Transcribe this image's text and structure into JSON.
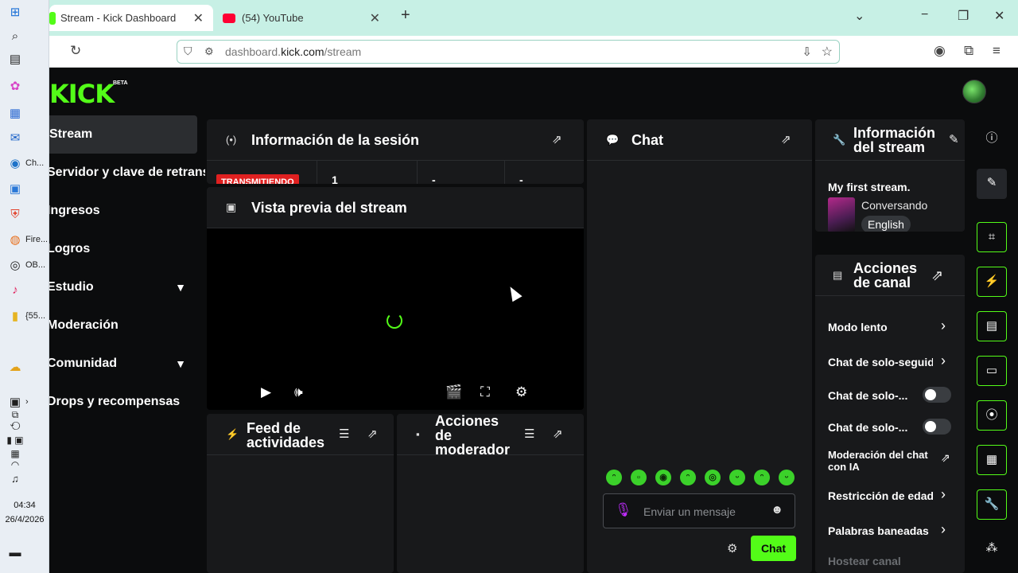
{
  "taskbar": {
    "apps": [
      {
        "icon": "windows-icon",
        "glyph": "⊞",
        "label": ""
      },
      {
        "icon": "search-icon",
        "glyph": "⌕",
        "label": ""
      },
      {
        "icon": "task-view-icon",
        "glyph": "▤",
        "label": ""
      },
      {
        "icon": "copilot-icon",
        "glyph": "✿",
        "label": ""
      },
      {
        "icon": "store-icon",
        "glyph": "▦",
        "label": ""
      },
      {
        "icon": "outlook-icon",
        "glyph": "✉",
        "label": ""
      },
      {
        "icon": "chrome-icon",
        "glyph": "◉",
        "label": "Ch..."
      },
      {
        "icon": "photos-icon",
        "glyph": "▣",
        "label": ""
      },
      {
        "icon": "brave-icon",
        "glyph": "⛨",
        "label": ""
      },
      {
        "icon": "firefox-icon",
        "glyph": "◍",
        "label": "Fire..."
      },
      {
        "icon": "obs-icon",
        "glyph": "◎",
        "label": "OB..."
      },
      {
        "icon": "tiktok-icon",
        "glyph": "♪",
        "label": ""
      },
      {
        "icon": "folder-icon",
        "glyph": "▮",
        "label": "{55..."
      }
    ],
    "time": "04:34",
    "date": "26/4/2026"
  },
  "browser": {
    "tabs": [
      {
        "label": "Stream - Kick Dashboard",
        "active": true
      },
      {
        "label": "(54) YouTube",
        "active": false
      }
    ],
    "url_prefix": "dashboard.",
    "url_domain": "kick.com",
    "url_path": "/stream"
  },
  "kick": {
    "logo": "KICK",
    "beta": "BETA",
    "sidebar": [
      {
        "label": "Stream",
        "active": true,
        "chevron": false
      },
      {
        "label": "Servidor y clave de retransmisión",
        "active": false,
        "chevron": false
      },
      {
        "label": "Ingresos",
        "active": false,
        "chevron": false
      },
      {
        "label": "Logros",
        "active": false,
        "chevron": false
      },
      {
        "label": "Estudio",
        "active": false,
        "chevron": true
      },
      {
        "label": "Moderación",
        "active": false,
        "chevron": false
      },
      {
        "label": "Comunidad",
        "active": false,
        "chevron": true
      },
      {
        "label": "Drops y recompensas",
        "active": false,
        "chevron": false
      }
    ],
    "session": {
      "title": "Información de la sesión",
      "status": "TRANSMITIENDO",
      "stats": [
        "1",
        "-",
        "-"
      ]
    },
    "preview": {
      "title": "Vista previa del stream"
    },
    "feed": {
      "title": "Feed de actividades"
    },
    "mod": {
      "title": "Acciones de moderador"
    },
    "chat": {
      "title": "Chat",
      "placeholder": "Enviar un mensaje",
      "send": "Chat",
      "emote_count": 8
    },
    "stream_info": {
      "title": "Información del stream",
      "stream_title": "My first stream.",
      "category": "Conversando",
      "language": "English"
    },
    "channel_actions": {
      "title": "Acciones de canal",
      "items": [
        {
          "label": "Modo lento",
          "control": "arrow"
        },
        {
          "label": "Chat de solo-seguidores",
          "control": "arrow"
        },
        {
          "label": "Chat de solo-...",
          "control": "toggle"
        },
        {
          "label": "Chat de solo-...",
          "control": "toggle"
        },
        {
          "label": "Moderación del chat con IA",
          "control": "external"
        },
        {
          "label": "Restricción de edad",
          "control": "arrow"
        },
        {
          "label": "Palabras baneadas",
          "control": "arrow"
        },
        {
          "label": "Hostear canal",
          "control": "none"
        }
      ]
    },
    "right_rail": [
      "info-icon",
      "pencil-icon",
      "scan-icon",
      "bolt-icon",
      "notes-icon",
      "chat-bubble-icon",
      "broadcast-icon",
      "layout-icon",
      "wrench-icon",
      "nodes-icon"
    ]
  }
}
